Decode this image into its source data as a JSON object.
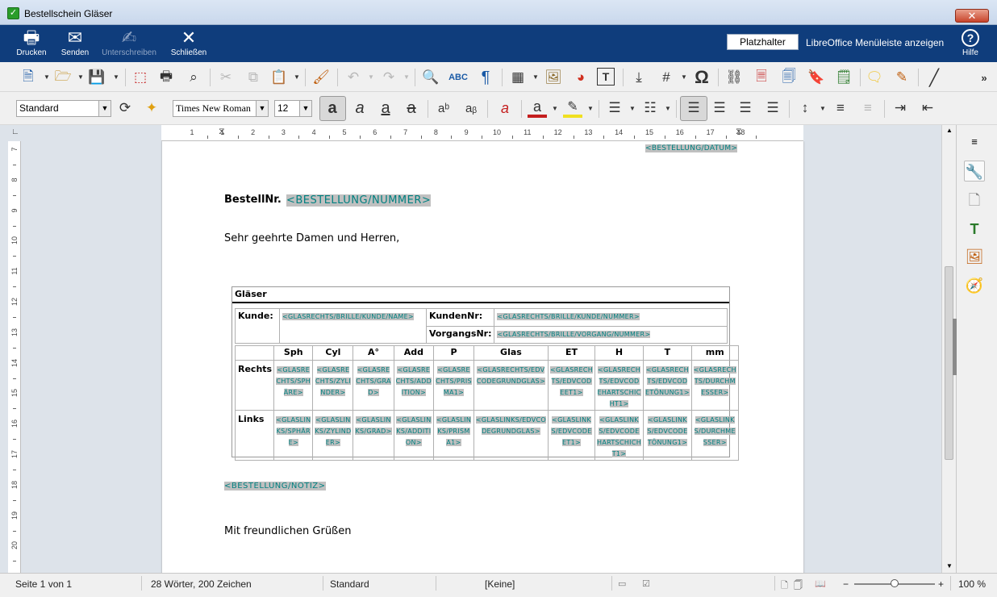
{
  "window": {
    "title": "Bestellschein Gläser",
    "close_label": "✕"
  },
  "bluebar": {
    "print": "Drucken",
    "send": "Senden",
    "sign": "Unterschreiben",
    "close": "Schließen",
    "placeholder": "Platzhalter",
    "menu_toggle": "LibreOffice Menüleiste anzeigen",
    "help": "Hilfe",
    "help_glyph": "?"
  },
  "toolbar2": {
    "style": "Standard",
    "font": "Times New Roman",
    "size": "12"
  },
  "ruler": {
    "h_ticks": [
      "1",
      "1",
      "2",
      "3",
      "4",
      "5",
      "6",
      "7",
      "8",
      "9",
      "10",
      "11",
      "12",
      "13",
      "14",
      "15",
      "16",
      "17",
      "18"
    ],
    "v_ticks": [
      "7",
      "8",
      "9",
      "10",
      "11",
      "12",
      "13",
      "14",
      "15",
      "16",
      "17",
      "18",
      "19",
      "20"
    ]
  },
  "document": {
    "datum_field": "<BESTELLUNG/DATUM>",
    "bestellnr_label": "BestellNr.",
    "bestellnr_field": "<BESTELLUNG/NUMMER>",
    "greeting": "Sehr geehrte Damen und Herren,",
    "notiz_field": "<BESTELLUNG/NOTIZ>",
    "closing": "Mit freundlichen Grüßen",
    "table": {
      "title": "Gläser",
      "kunde_label": "Kunde:",
      "kunde_name": "<GLASRECHTS/BRILLE/KUNDE/NAME>",
      "kundennr_label": "KundenNr:",
      "kundennr_value": "<GLASRECHTS/BRILLE/KUNDE/NUMMER>",
      "vorgangsnr_label": "VorgangsNr:",
      "vorgangsnr_value": "<GLASRECHTS/BRILLE/VORGANG/NUMMER>",
      "columns": [
        "Sph",
        "Cyl",
        "A°",
        "Add",
        "P",
        "Glas",
        "ET",
        "H",
        "T",
        "mm"
      ],
      "rows": [
        {
          "label": "Rechts",
          "cells": [
            "<GLASRE CHTS/SPH ÄRE>",
            "<GLASRE CHTS/ZYLI NDER>",
            "<GLASRE CHTS/GRA D>",
            "<GLASRE CHTS/ADD ITION>",
            "<GLASRE CHTS/PRIS MA1>",
            "<GLASRECHTS/EDV CODEGRUNDGLAS>",
            "<GLASRECH TS/EDVCOD EET1>",
            "<GLASRECH TS/EDVCOD EHARTSCHIC HT1>",
            "<GLASRECH TS/EDVCOD ETÖNUNG1>",
            "<GLASRECH TS/DURCHM ESSER>"
          ]
        },
        {
          "label": "Links",
          "cells": [
            "<GLASLIN KS/SPHÄR E>",
            "<GLASLIN KS/ZYLIND ER>",
            "<GLASLIN KS/GRAD>",
            "<GLASLIN KS/ADDITI ON>",
            "<GLASLIN KS/PRISM A1>",
            "<GLASLINKS/EDVCO DEGRUNDGLAS>",
            "<GLASLINK S/EDVCODE ET1>",
            "<GLASLINK S/EDVCODE HARTSCHICH T1>",
            "<GLASLINK S/EDVCODE TÖNUNG1>",
            "<GLASLINK S/DURCHME SSER>"
          ]
        }
      ]
    }
  },
  "statusbar": {
    "page": "Seite 1 von 1",
    "words": "28 Wörter, 200 Zeichen",
    "style": "Standard",
    "language": "[Keine]",
    "zoom": "100 %",
    "zoom_minus": "−",
    "zoom_plus": "+"
  },
  "colors": {
    "bluebar": "#0f3d7c",
    "field_text": "#008080",
    "field_bg": "#c0c0c0"
  }
}
